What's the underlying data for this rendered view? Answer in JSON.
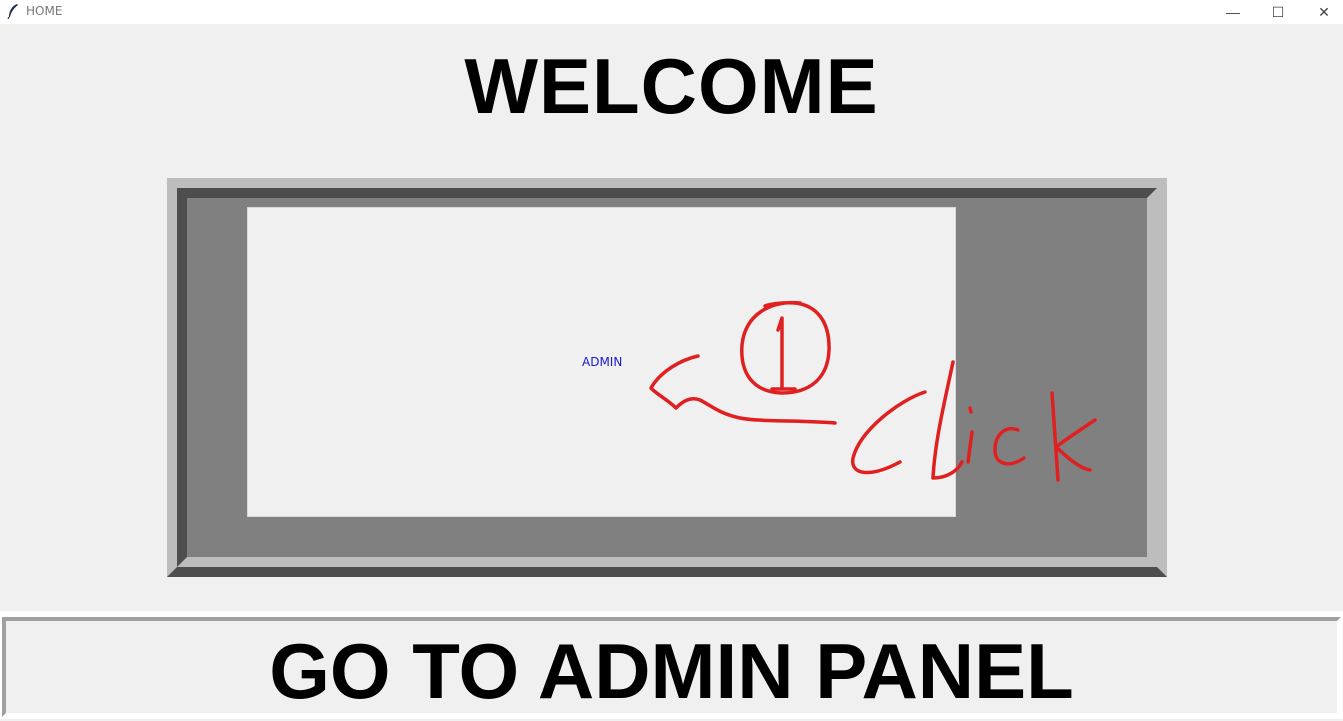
{
  "window": {
    "title": "HOME",
    "app_icon": "feather-icon",
    "controls": {
      "minimize": "—",
      "maximize": "☐",
      "close": "✕"
    }
  },
  "header": {
    "welcome_text": "WELCOME"
  },
  "panel": {
    "admin_label": "ADMIN",
    "admin_label_color": "#1b1bd0",
    "annotation_color": "#e02020"
  },
  "footer": {
    "button_label": "GO TO ADMIN PANEL"
  }
}
